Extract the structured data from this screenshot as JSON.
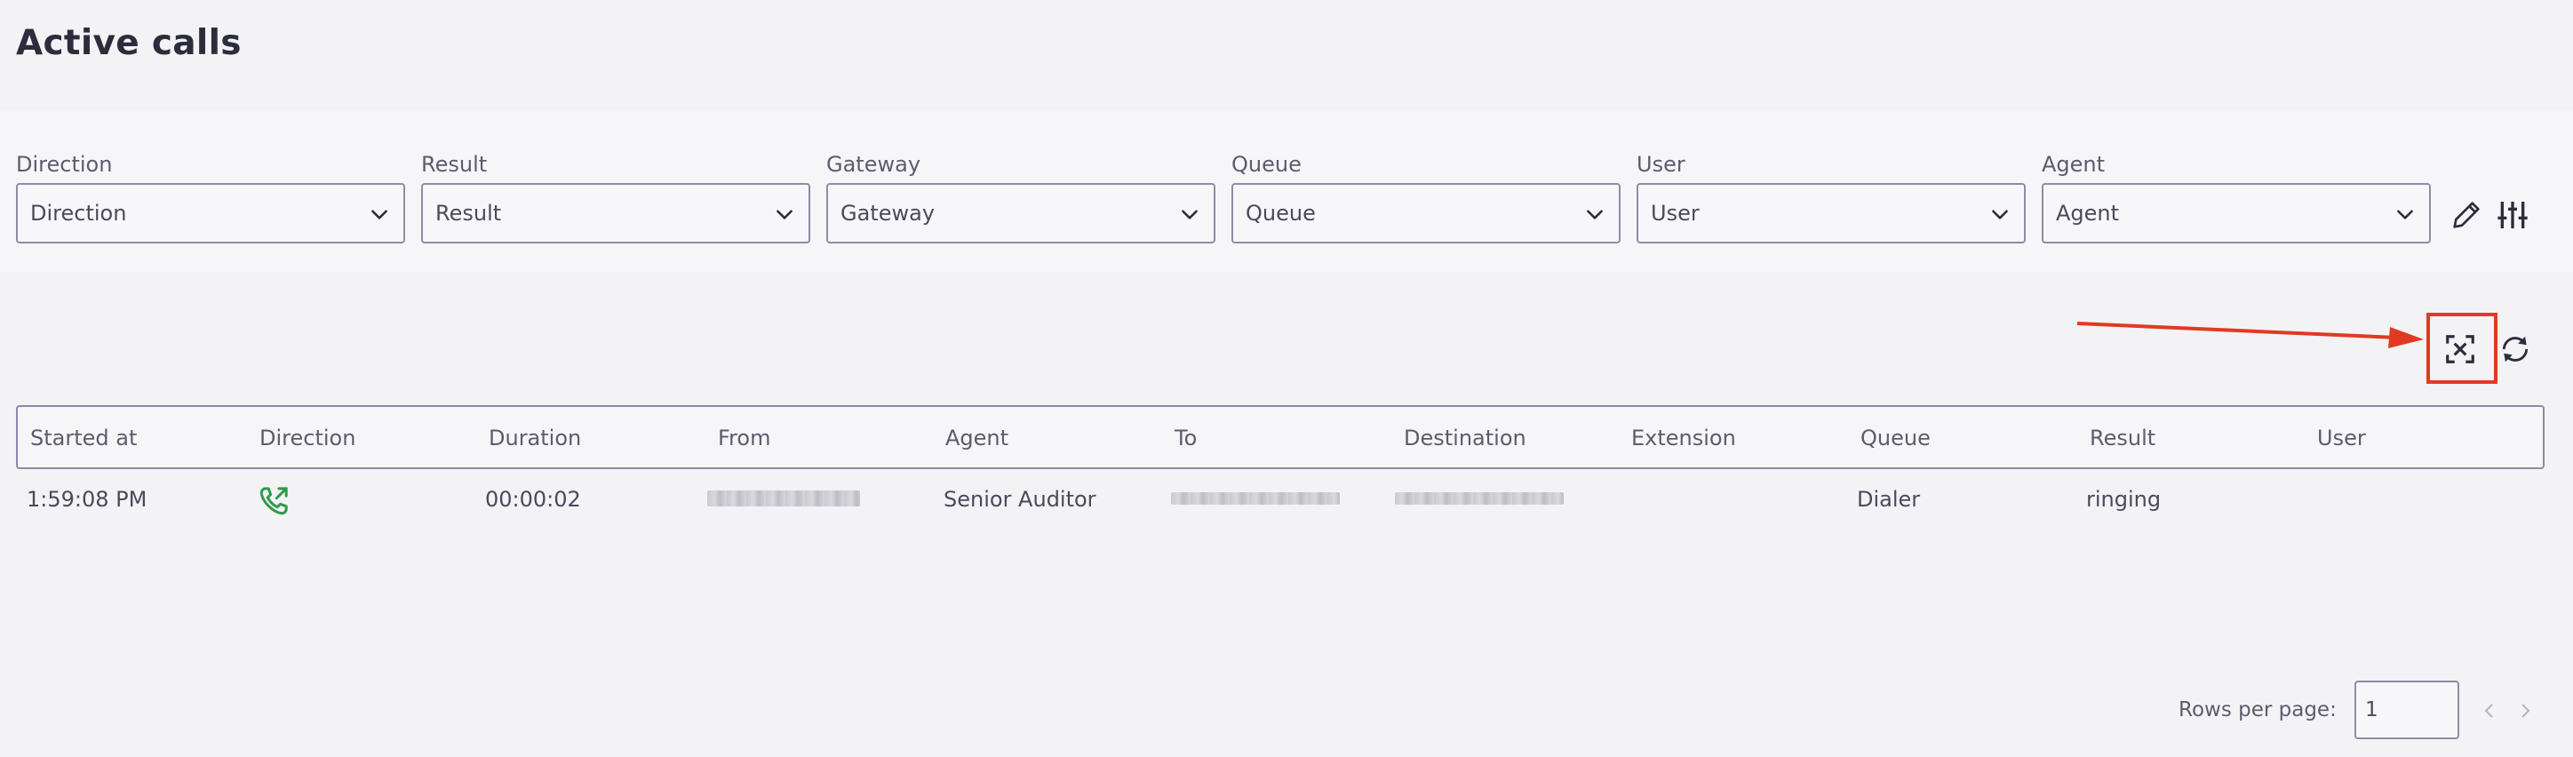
{
  "header": {
    "title": "Active calls"
  },
  "filters": [
    {
      "label": "Direction",
      "value": "Direction"
    },
    {
      "label": "Result",
      "value": "Result"
    },
    {
      "label": "Gateway",
      "value": "Gateway"
    },
    {
      "label": "Queue",
      "value": "Queue"
    },
    {
      "label": "User",
      "value": "User"
    },
    {
      "label": "Agent",
      "value": "Agent"
    }
  ],
  "toolbar": {
    "edit_icon": "pencil-icon",
    "columns_icon": "sliders-icon",
    "fullscreen_icon": "fullscreen-icon",
    "refresh_icon": "refresh-icon"
  },
  "table": {
    "columns": [
      "Started at",
      "Direction",
      "Duration",
      "From",
      "Agent",
      "To",
      "Destination",
      "Extension",
      "Queue",
      "Result",
      "User"
    ],
    "rows": [
      {
        "started_at": "1:59:08 PM",
        "direction_icon": "outgoing-call-icon",
        "duration": "00:00:02",
        "from": "",
        "agent": "Senior Auditor",
        "to": "",
        "destination": "",
        "extension": "",
        "queue": "Dialer",
        "result": "ringing",
        "user": ""
      }
    ]
  },
  "pagination": {
    "rows_per_page_label": "Rows per page:",
    "rows_per_page_value": "1"
  },
  "colors": {
    "annotation": "#e03a22",
    "call_icon": "#2e9a4a",
    "border": "#8a8aa8"
  }
}
